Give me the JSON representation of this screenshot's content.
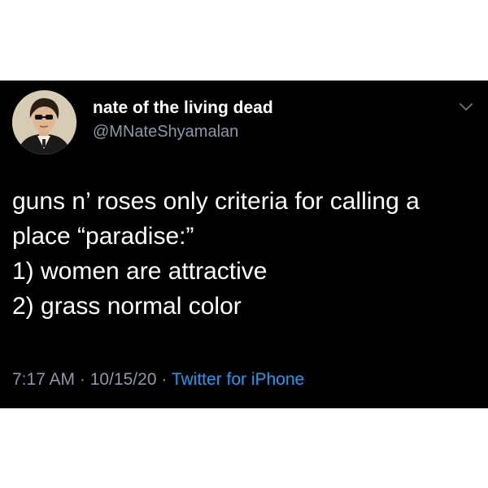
{
  "author": {
    "display_name": "nate of the living dead",
    "handle": "@MNateShyamalan",
    "avatar_icon": "portrait-avatar-icon"
  },
  "tweet": {
    "lines": [
      "guns n’ roses only criteria for calling a",
      "place “paradise:”",
      "1) women are attractive",
      "2) grass normal color"
    ]
  },
  "meta": {
    "time": "7:17 AM",
    "separator": "·",
    "date": "10/15/20",
    "source": "Twitter for iPhone"
  },
  "menu": {
    "icon": "chevron-down-icon"
  },
  "colors": {
    "background": "#000000",
    "text": "#ffffff",
    "secondary": "#8b98a5",
    "link": "#1d9bf0"
  }
}
